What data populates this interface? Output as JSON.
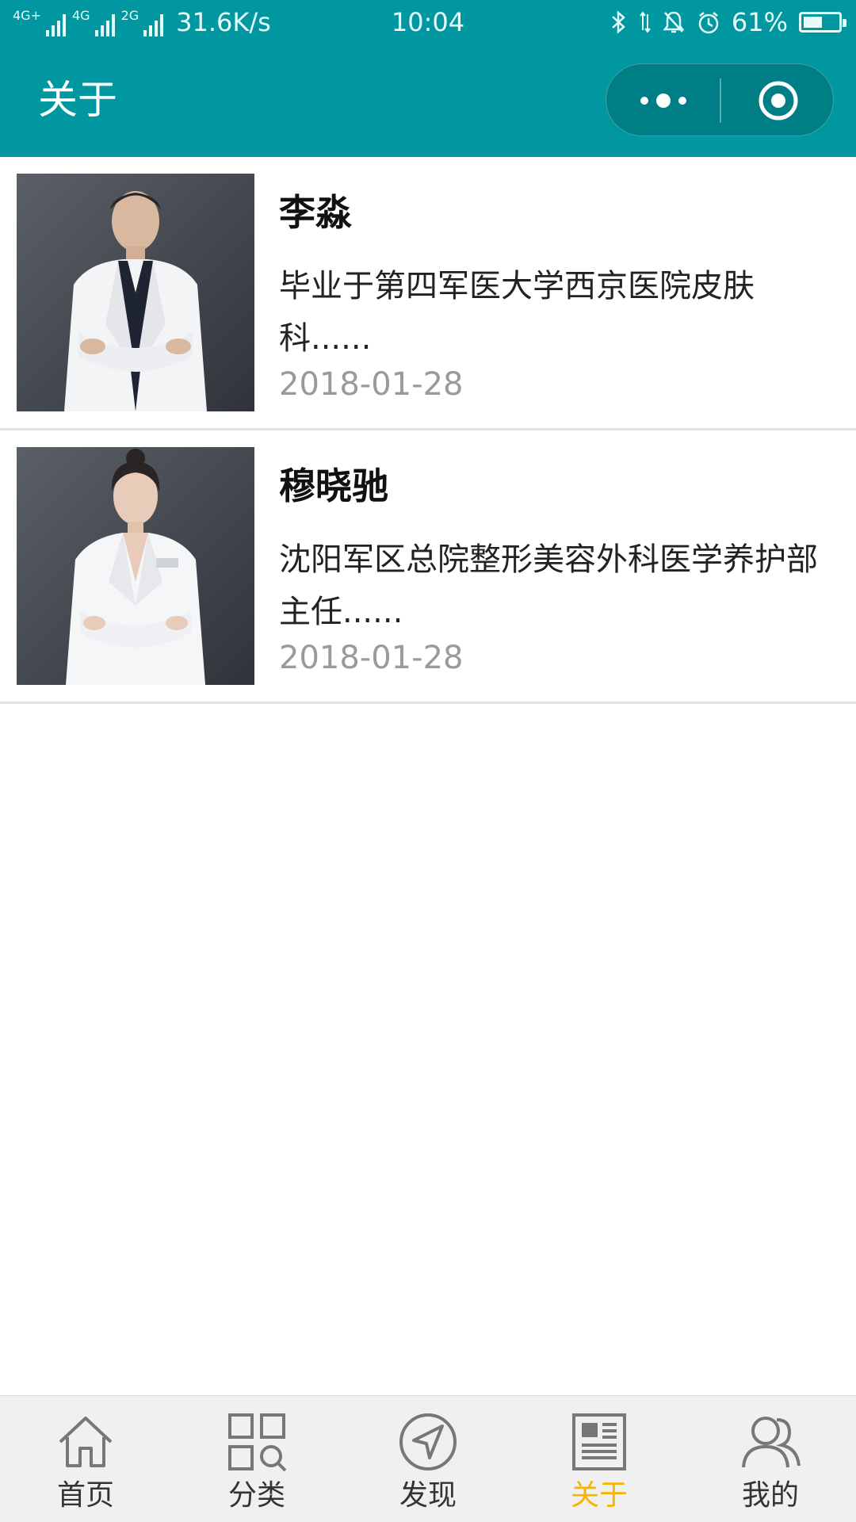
{
  "status_bar": {
    "net1": "4G+",
    "net2": "4G",
    "net3": "2G",
    "speed": "31.6K/s",
    "time": "10:04",
    "battery_pct": "61%",
    "battery_level": 0.61,
    "icons": [
      "bluetooth-icon",
      "data-transfer-icon",
      "bell-muted-icon",
      "alarm-icon",
      "battery-icon"
    ]
  },
  "header": {
    "title": "关于",
    "bg_color": "#0097a0",
    "capsule": {
      "more_icon": "more-dots-icon",
      "close_icon": "target-close-icon"
    }
  },
  "list": [
    {
      "name": "李淼",
      "desc": "毕业于第四军医大学西京医院皮肤科......",
      "date": "2018-01-28",
      "photo_icon": "doctor-portrait-male"
    },
    {
      "name": "穆晓驰",
      "desc": "沈阳军区总院整形美容外科医学养护部主任......",
      "date": "2018-01-28",
      "photo_icon": "doctor-portrait-female"
    }
  ],
  "tabbar": {
    "active_color": "#f7b500",
    "items": [
      {
        "label": "首页",
        "icon": "home-icon"
      },
      {
        "label": "分类",
        "icon": "category-grid-icon"
      },
      {
        "label": "发现",
        "icon": "discover-compass-icon"
      },
      {
        "label": "关于",
        "icon": "about-newspaper-icon",
        "active": true
      },
      {
        "label": "我的",
        "icon": "users-icon"
      }
    ]
  }
}
